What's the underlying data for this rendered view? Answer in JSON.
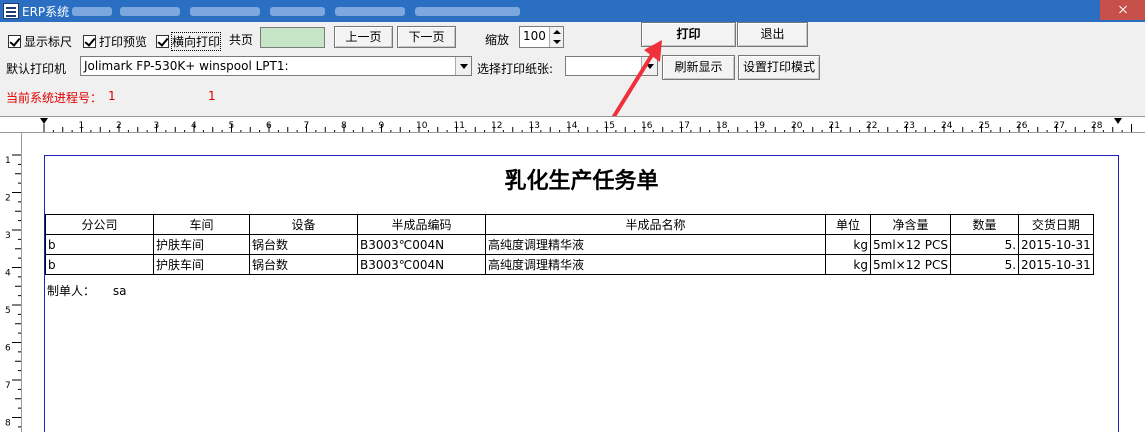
{
  "window": {
    "title": "ERP系统"
  },
  "toolbar": {
    "show_ruler": "显示标尺",
    "print_preview": "打印预览",
    "landscape_print": "横向打印",
    "total_pages_label": "共页",
    "total_pages_value": "",
    "prev_page": "上一页",
    "next_page": "下一页",
    "zoom_label": "缩放",
    "zoom_value": "100",
    "print": "打印",
    "exit": "退出",
    "default_printer_label": "默认打印机",
    "default_printer_value": "Jolimark FP-530K+  winspool  LPT1:",
    "select_paper_label": "选择打印纸张:",
    "select_paper_value": "",
    "refresh": "刷新显示",
    "print_mode": "设置打印模式"
  },
  "status": {
    "process_label": "当前系统进程号：",
    "process_value_1": "1",
    "process_value_2": "1"
  },
  "ruler": {
    "numbers": [
      "1",
      "2",
      "3",
      "4",
      "5",
      "6",
      "7",
      "8",
      "9",
      "10",
      "11",
      "12",
      "13",
      "14",
      "15",
      "16",
      "17",
      "18",
      "19",
      "20",
      "21",
      "22",
      "23",
      "24",
      "25",
      "26",
      "27",
      "28",
      "29"
    ],
    "vnumbers": [
      "1",
      "2",
      "3",
      "4",
      "5",
      "6",
      "7",
      "8"
    ]
  },
  "document": {
    "title": "乳化生产任务单",
    "headers": [
      "分公司",
      "车间",
      "设备",
      "半成品编码",
      "半成品名称",
      "单位",
      "净含量",
      "数量",
      "交货日期"
    ],
    "rows": [
      [
        "b",
        "护肤车间",
        "锅台数",
        "B3003℃004N",
        "高纯度调理精华液",
        "kg",
        "5ml×12 PCS",
        "5.",
        "2015-10-31"
      ],
      [
        "b",
        "护肤车间",
        "锅台数",
        "B3003℃004N",
        "高纯度调理精华液",
        "kg",
        "5ml×12 PCS",
        "5.",
        "2015-10-31"
      ]
    ],
    "maker_label": "制单人：",
    "maker_value": "sa"
  },
  "colors": {
    "titlebar": "#2b6fc3",
    "status_red": "#e00000",
    "page_border": "#2020c0",
    "annotation_arrow": "#f0303a"
  }
}
